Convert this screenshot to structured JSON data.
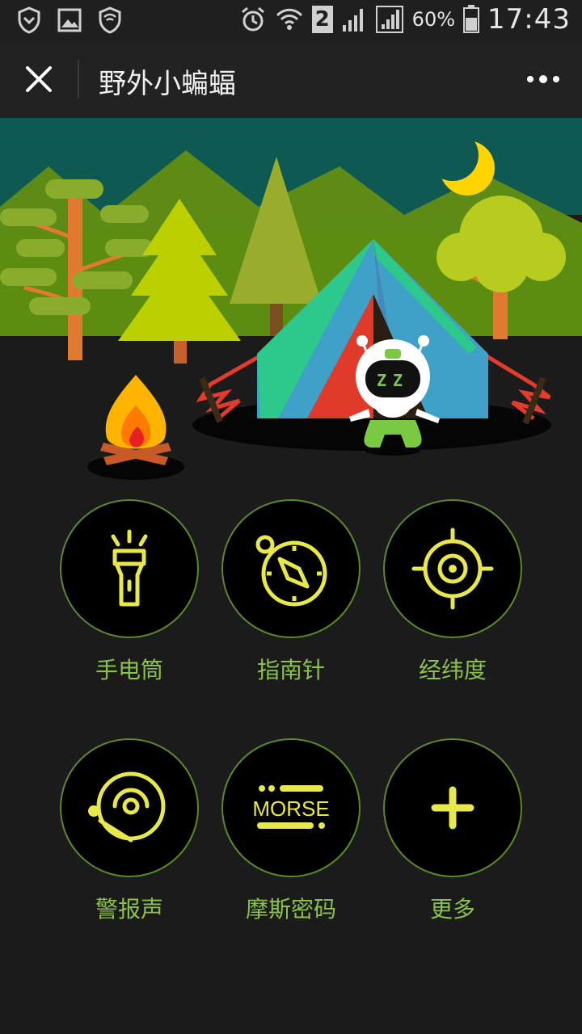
{
  "statusbar": {
    "battery": "60%",
    "time": "17:43",
    "sim_slot": "2"
  },
  "titlebar": {
    "title": "野外小蝙蝠"
  },
  "hero": {
    "robot_text": "ZZ"
  },
  "tools": [
    {
      "id": "flashlight",
      "label": "手电筒"
    },
    {
      "id": "compass",
      "label": "指南针"
    },
    {
      "id": "coordinates",
      "label": "经纬度"
    },
    {
      "id": "alarm",
      "label": "警报声"
    },
    {
      "id": "morse",
      "label": "摩斯密码",
      "icon_text": "MORSE"
    },
    {
      "id": "more",
      "label": "更多"
    }
  ],
  "colors": {
    "accent": "#e8e84a",
    "label_green": "#8bc34a",
    "ring": "#5b8a2a"
  }
}
